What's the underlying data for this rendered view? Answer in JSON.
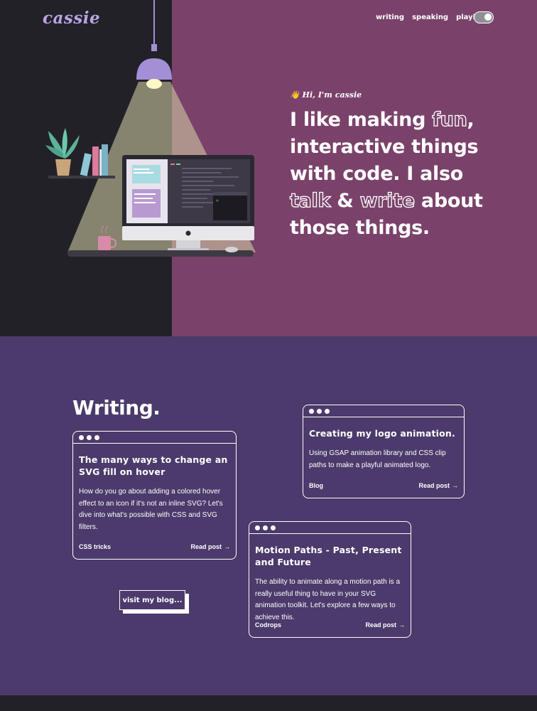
{
  "site": {
    "logo_text": "cassie"
  },
  "nav": {
    "items": [
      "writing",
      "speaking",
      "playing"
    ],
    "toggle_state": "on"
  },
  "hero": {
    "intro_wave": "👋",
    "intro_text": "Hi, I'm cassie",
    "line1_a": "I like making ",
    "line1_fun": "fun",
    "line1_b": ",",
    "line2": "interactive things",
    "line3": "with code. I also",
    "line4_talk": "talk",
    "line4_amp": " & ",
    "line4_write": "write",
    "line4_b": " about",
    "line5": "those things."
  },
  "writing": {
    "title": "Writing.",
    "cards": [
      {
        "title": "The many ways to change an SVG fill on hover",
        "body": "How do you go about adding a colored hover effect to an icon if it's not an inline SVG? Let's dive into what's possible with CSS and SVG filters.",
        "source": "CSS tricks",
        "read_label": "Read post",
        "arrow": "→"
      },
      {
        "title": "Creating my logo animation.",
        "body": "Using GSAP animation library and CSS clip paths to make a playful animated logo.",
        "source": "Blog",
        "read_label": "Read post",
        "arrow": "→"
      },
      {
        "title": "Motion Paths - Past, Present and Future",
        "body": "The ability to animate along a motion path is a really useful thing to have in your SVG animation toolkit. Let's explore a few ways to achieve this.",
        "source": "Codrops",
        "read_label": "Read post",
        "arrow": "→"
      }
    ],
    "blog_button": "visit my blog..."
  },
  "colors": {
    "dark": "#232128",
    "plum": "#7a426a",
    "purple": "#4b3a6b",
    "lavender": "#b8a4e6",
    "white": "#ffffff"
  }
}
